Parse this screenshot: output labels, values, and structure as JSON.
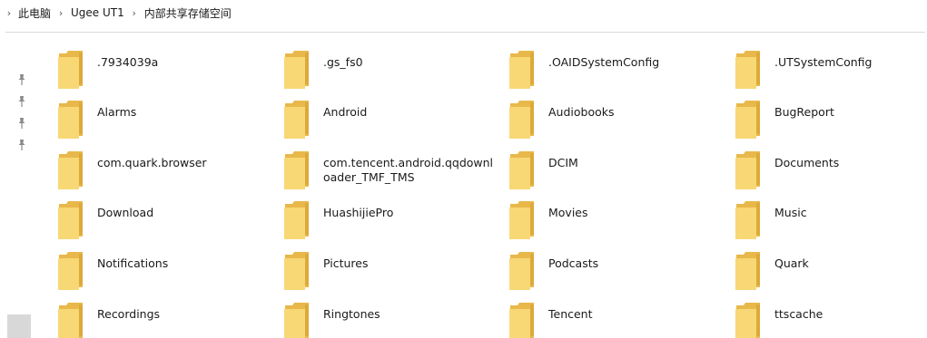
{
  "breadcrumb": [
    {
      "label": "此电脑"
    },
    {
      "label": "Ugee UT1"
    },
    {
      "label": "内部共享存储空间"
    }
  ],
  "pins": [
    {
      "icon": "pin-icon"
    },
    {
      "icon": "pin-icon"
    },
    {
      "icon": "pin-icon"
    },
    {
      "icon": "pin-icon"
    }
  ],
  "folders": [
    {
      "name": ".7934039a"
    },
    {
      "name": ".gs_fs0"
    },
    {
      "name": ".OAIDSystemConfig"
    },
    {
      "name": ".UTSystemConfig"
    },
    {
      "name": "Alarms"
    },
    {
      "name": "Android"
    },
    {
      "name": "Audiobooks"
    },
    {
      "name": "BugReport"
    },
    {
      "name": "com.quark.browser"
    },
    {
      "name": "com.tencent.android.qqdownloader_TMF_TMS"
    },
    {
      "name": "DCIM"
    },
    {
      "name": "Documents"
    },
    {
      "name": "Download"
    },
    {
      "name": "HuashijiePro"
    },
    {
      "name": "Movies"
    },
    {
      "name": "Music"
    },
    {
      "name": "Notifications"
    },
    {
      "name": "Pictures"
    },
    {
      "name": "Podcasts"
    },
    {
      "name": "Quark"
    },
    {
      "name": "Recordings"
    },
    {
      "name": "Ringtones"
    },
    {
      "name": "Tencent"
    },
    {
      "name": "ttscache"
    }
  ],
  "colors": {
    "folder_front": "#f8d775",
    "folder_back": "#e8b84a",
    "folder_tab": "#dcaa3a",
    "divider": "#d9d9d9",
    "pin": "#8a8a8a"
  }
}
